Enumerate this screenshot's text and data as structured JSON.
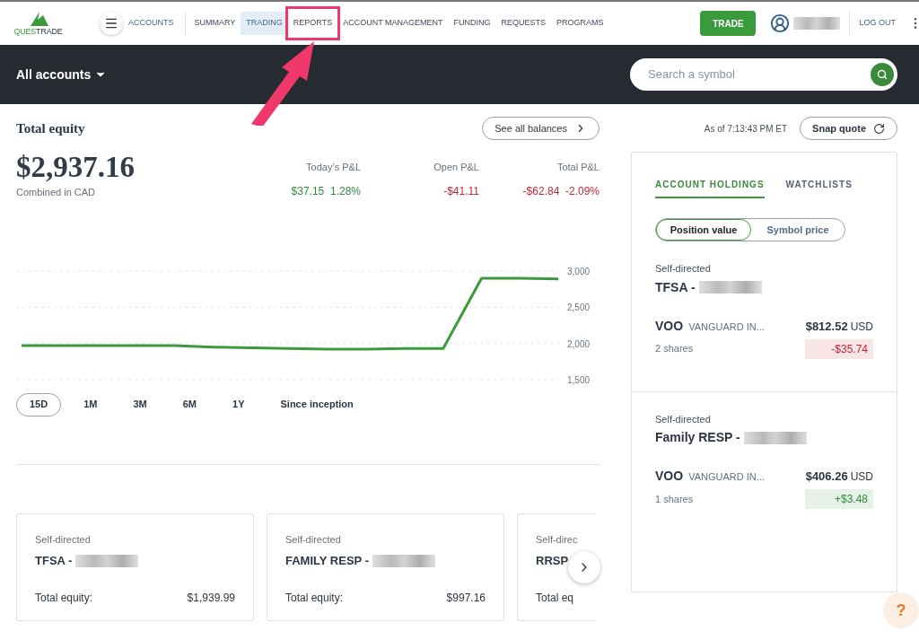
{
  "nav": {
    "logo": {
      "part_1": "QUES",
      "part_2": "TRADE"
    },
    "accounts_link": "ACCOUNTS",
    "items": [
      {
        "label": "SUMMARY",
        "selected": false,
        "highlighted": false
      },
      {
        "label": "TRADING",
        "selected": true,
        "highlighted": false
      },
      {
        "label": "REPORTS",
        "selected": false,
        "highlighted": true
      },
      {
        "label": "ACCOUNT MANAGEMENT",
        "selected": false,
        "highlighted": false
      },
      {
        "label": "FUNDING",
        "selected": false,
        "highlighted": false
      },
      {
        "label": "REQUESTS",
        "selected": false,
        "highlighted": false
      },
      {
        "label": "PROGRAMS",
        "selected": false,
        "highlighted": false
      }
    ],
    "trade_button": "TRADE",
    "user_redacted": true,
    "logout": "LOG OUT"
  },
  "account_bar": {
    "selector": "All accounts",
    "search": {
      "placeholder": "Search a symbol"
    }
  },
  "equity": {
    "title": "Total equity",
    "see_all": "See all balances",
    "amount": "$2,937.16",
    "currency_note": "Combined in CAD",
    "pnl": [
      {
        "label": "Today’s P&L",
        "values": [
          "$37.15",
          "1.28%"
        ],
        "color": "#2e8b3a"
      },
      {
        "label": "Open P&L",
        "values": [
          "-$41.11"
        ],
        "color": "#c0283c"
      },
      {
        "label": "Total P&L",
        "values": [
          "-$62.84",
          "-2.09%"
        ],
        "color": "#c0283c"
      }
    ],
    "chart_data": {
      "type": "line",
      "grid": true,
      "series": [
        {
          "color": "#3a9a3c",
          "values": [
            1970,
            1970,
            1970,
            1970,
            1970,
            1950,
            1940,
            1930,
            1920,
            1920,
            1930,
            1930,
            2900,
            2900,
            2890
          ]
        }
      ],
      "ylim": [
        1500,
        3000
      ],
      "yticks": [
        {
          "value": 1500,
          "label": "1,500"
        },
        {
          "value": 2000,
          "label": "2,000"
        },
        {
          "value": 2500,
          "label": "2,500"
        },
        {
          "value": 3000,
          "label": "3,000"
        }
      ]
    },
    "ranges": [
      {
        "label": "15D",
        "selected": true
      },
      {
        "label": "1M",
        "selected": false
      },
      {
        "label": "3M",
        "selected": false
      },
      {
        "label": "6M",
        "selected": false
      },
      {
        "label": "1Y",
        "selected": false
      },
      {
        "label": "Since inception",
        "selected": false
      }
    ]
  },
  "account_cards": [
    {
      "type": "Self-directed",
      "name": "TFSA -",
      "redacted": true,
      "equity_label": "Total equity:",
      "equity": "$1,939.99"
    },
    {
      "type": "Self-directed",
      "name": "FAMILY RESP -",
      "redacted": true,
      "equity_label": "Total equity:",
      "equity": "$997.16"
    },
    {
      "type": "Self-direc",
      "name": "RRSP",
      "redacted": false,
      "equity_label": "Total eq"
    }
  ],
  "quote": {
    "as_of": "As of 7:13:43 PM ET",
    "snap_quote": "Snap quote"
  },
  "holdings": {
    "tabs": [
      {
        "label": "ACCOUNT HOLDINGS",
        "selected": true
      },
      {
        "label": "WATCHLISTS",
        "selected": false
      }
    ],
    "toggle": [
      {
        "label": "Position value",
        "selected": true
      },
      {
        "label": "Symbol price",
        "selected": false
      }
    ],
    "groups": [
      {
        "type": "Self-directed",
        "account": "TFSA -",
        "redacted": true,
        "positions": [
          {
            "symbol": "VOO",
            "description": "VANGUARD IN...",
            "value": "$812.52",
            "currency": "USD",
            "shares": "2 shares",
            "change": "-$35.74",
            "color": "#c0283c"
          }
        ]
      },
      {
        "type": "Self-directed",
        "account": "Family RESP -",
        "redacted": true,
        "positions": [
          {
            "symbol": "VOO",
            "description": "VANGUARD IN...",
            "value": "$406.26",
            "currency": "USD",
            "shares": "1 shares",
            "change": "+$3.48",
            "color": "#2e8b3a"
          }
        ]
      }
    ]
  },
  "help": "?"
}
